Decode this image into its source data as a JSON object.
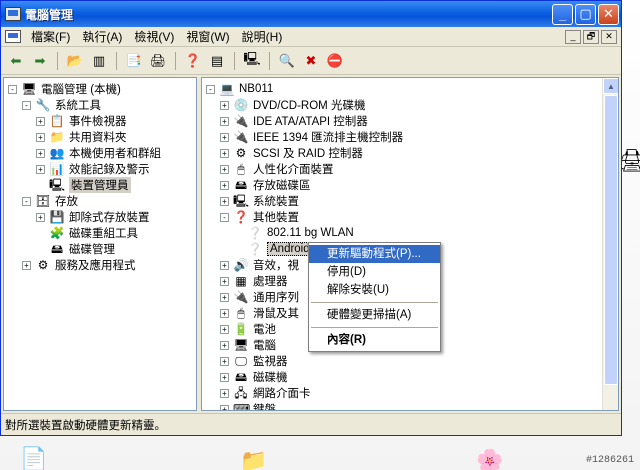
{
  "window": {
    "title": "電腦管理"
  },
  "menubar": {
    "items": [
      "檔案(F)",
      "執行(A)",
      "檢視(V)",
      "視窗(W)",
      "說明(H)"
    ],
    "mdi_controls": [
      "_",
      "🗗",
      "✕"
    ]
  },
  "left_tree": [
    {
      "label": "電腦管理 (本機)",
      "indent": 0,
      "exp": "-",
      "icon": "computer-manage-icon",
      "glyph": "🖥"
    },
    {
      "label": "系統工具",
      "indent": 1,
      "exp": "-",
      "icon": "system-tools-icon",
      "glyph": "🔧"
    },
    {
      "label": "事件檢視器",
      "indent": 2,
      "exp": "+",
      "icon": "event-viewer-icon",
      "glyph": "📋"
    },
    {
      "label": "共用資料夾",
      "indent": 2,
      "exp": "+",
      "icon": "shared-folder-icon",
      "glyph": "📁"
    },
    {
      "label": "本機使用者和群組",
      "indent": 2,
      "exp": "+",
      "icon": "users-groups-icon",
      "glyph": "👥"
    },
    {
      "label": "效能記錄及警示",
      "indent": 2,
      "exp": "+",
      "icon": "performance-icon",
      "glyph": "📊"
    },
    {
      "label": "裝置管理員",
      "indent": 2,
      "exp": "",
      "icon": "device-manager-icon",
      "glyph": "🖳",
      "selected": true
    },
    {
      "label": "存放",
      "indent": 1,
      "exp": "-",
      "icon": "storage-icon",
      "glyph": "🗄"
    },
    {
      "label": "卸除式存放裝置",
      "indent": 2,
      "exp": "+",
      "icon": "removable-storage-icon",
      "glyph": "💾"
    },
    {
      "label": "磁碟重組工具",
      "indent": 2,
      "exp": "",
      "icon": "defrag-icon",
      "glyph": "🧩"
    },
    {
      "label": "磁碟管理",
      "indent": 2,
      "exp": "",
      "icon": "disk-management-icon",
      "glyph": "🖴"
    },
    {
      "label": "服務及應用程式",
      "indent": 1,
      "exp": "+",
      "icon": "services-icon",
      "glyph": "⚙"
    }
  ],
  "right_tree": [
    {
      "label": "NB011",
      "indent": 0,
      "exp": "-",
      "icon": "computer-icon",
      "glyph": "💻"
    },
    {
      "label": "DVD/CD-ROM 光碟機",
      "indent": 1,
      "exp": "+",
      "icon": "dvd-icon",
      "glyph": "💿"
    },
    {
      "label": "IDE ATA/ATAPI 控制器",
      "indent": 1,
      "exp": "+",
      "icon": "ide-controller-icon",
      "glyph": "🔌"
    },
    {
      "label": "IEEE 1394 匯流排主機控制器",
      "indent": 1,
      "exp": "+",
      "icon": "ieee1394-icon",
      "glyph": "🔌"
    },
    {
      "label": "SCSI 及 RAID 控制器",
      "indent": 1,
      "exp": "+",
      "icon": "scsi-icon",
      "glyph": "⚙"
    },
    {
      "label": "人性化介面裝置",
      "indent": 1,
      "exp": "+",
      "icon": "hid-icon",
      "glyph": "🖱"
    },
    {
      "label": "存放磁碟區",
      "indent": 1,
      "exp": "+",
      "icon": "storage-volume-icon",
      "glyph": "🖴"
    },
    {
      "label": "系統裝置",
      "indent": 1,
      "exp": "+",
      "icon": "system-device-icon",
      "glyph": "🖳"
    },
    {
      "label": "其他裝置",
      "indent": 1,
      "exp": "-",
      "icon": "other-devices-icon",
      "glyph": "❓"
    },
    {
      "label": "802.11 bg WLAN",
      "indent": 2,
      "exp": "",
      "icon": "unknown-device-icon",
      "glyph": "❔"
    },
    {
      "label": "Android",
      "indent": 2,
      "exp": "",
      "icon": "unknown-device-icon",
      "glyph": "❔",
      "focused": true
    },
    {
      "label": "音效，視",
      "indent": 1,
      "exp": "+",
      "icon": "sound-icon",
      "glyph": "🔊"
    },
    {
      "label": "處理器",
      "indent": 1,
      "exp": "+",
      "icon": "processor-icon",
      "glyph": "▦"
    },
    {
      "label": "通用序列",
      "indent": 1,
      "exp": "+",
      "icon": "usb-icon",
      "glyph": "🔌"
    },
    {
      "label": "滑鼠及其",
      "indent": 1,
      "exp": "+",
      "icon": "mouse-icon",
      "glyph": "🖱"
    },
    {
      "label": "電池",
      "indent": 1,
      "exp": "+",
      "icon": "battery-icon",
      "glyph": "🔋"
    },
    {
      "label": "電腦",
      "indent": 1,
      "exp": "+",
      "icon": "computer-node-icon",
      "glyph": "🖥"
    },
    {
      "label": "監視器",
      "indent": 1,
      "exp": "+",
      "icon": "monitor-icon",
      "glyph": "🖵"
    },
    {
      "label": "磁碟機",
      "indent": 1,
      "exp": "+",
      "icon": "disk-drive-icon",
      "glyph": "🖴"
    },
    {
      "label": "網路介面卡",
      "indent": 1,
      "exp": "+",
      "icon": "network-adapter-icon",
      "glyph": "🖧"
    },
    {
      "label": "鍵盤",
      "indent": 1,
      "exp": "+",
      "icon": "keyboard-icon",
      "glyph": "⌨"
    }
  ],
  "context_menu": [
    {
      "label": "更新驅動程式(P)...",
      "highlighted": true
    },
    {
      "label": "停用(D)"
    },
    {
      "label": "解除安裝(U)"
    },
    {
      "separator": true
    },
    {
      "label": "硬體變更掃描(A)"
    },
    {
      "separator": true
    },
    {
      "label": "內容(R)",
      "bold": true
    }
  ],
  "statusbar": {
    "text": "對所選裝置啟動硬體更新精靈。"
  },
  "watermark": "#1286261"
}
